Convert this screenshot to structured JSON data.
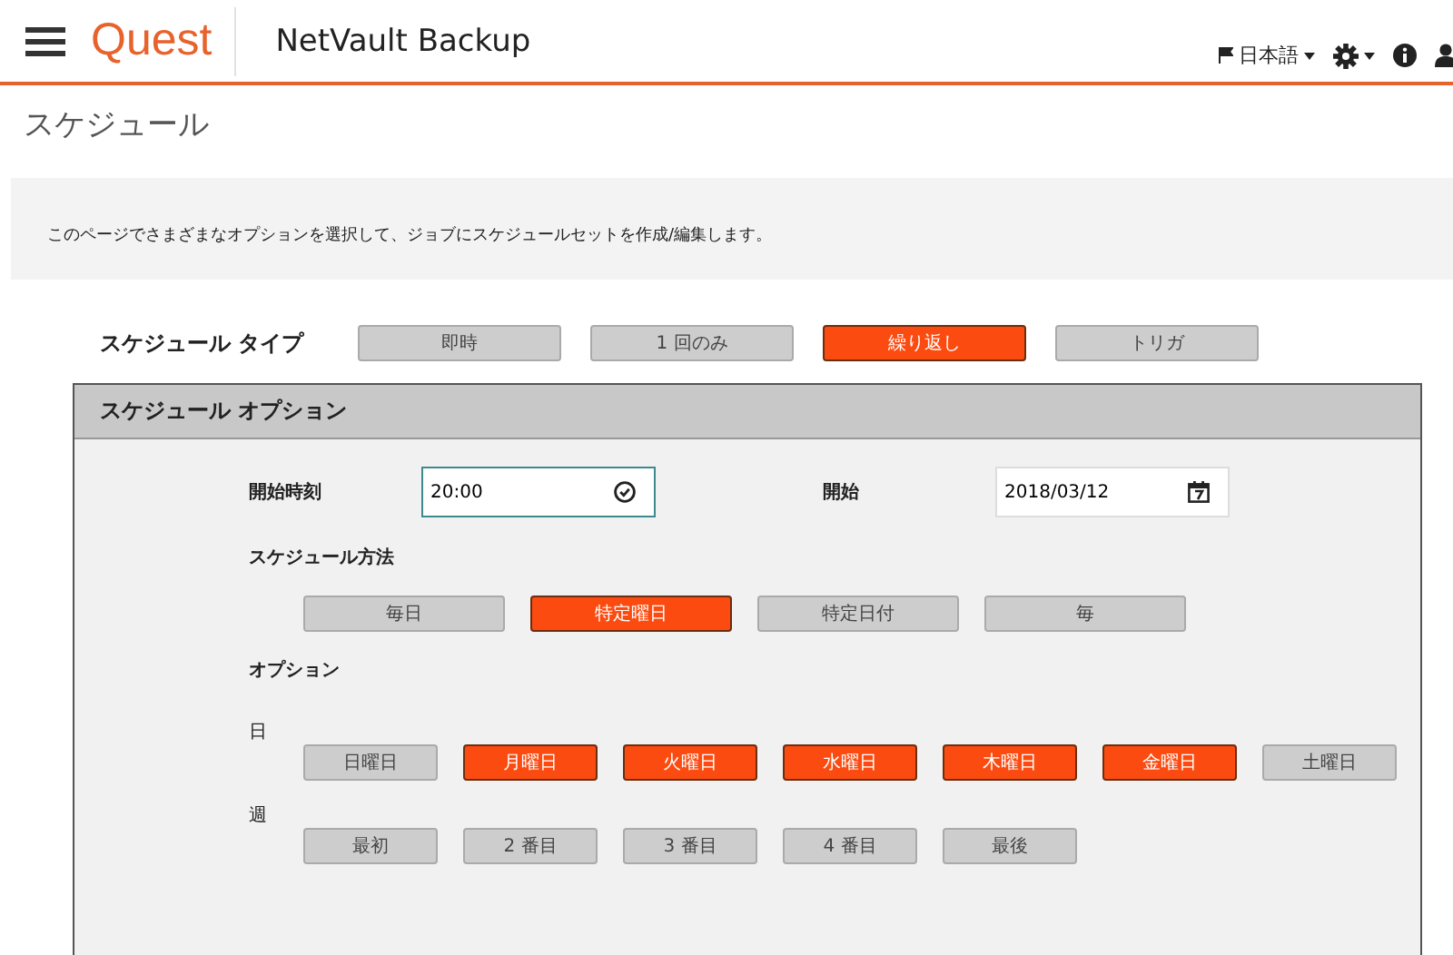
{
  "header": {
    "logo": "Quest",
    "product": "NetVault Backup",
    "language": "日本語"
  },
  "page_title": "スケジュール",
  "description": "このページでさまざまなオプションを選択して、ジョブにスケジュールセットを作成/編集します。",
  "schedule_type": {
    "label": "スケジュール タイプ",
    "options": [
      {
        "label": "即時",
        "selected": false
      },
      {
        "label": "1 回のみ",
        "selected": false
      },
      {
        "label": "繰り返し",
        "selected": true
      },
      {
        "label": "トリガ",
        "selected": false
      }
    ]
  },
  "schedule_options": {
    "title": "スケジュール オプション",
    "start_time": {
      "label": "開始時刻",
      "value": "20:00",
      "focused": true
    },
    "start_date": {
      "label": "開始",
      "value": "2018/03/12"
    },
    "method": {
      "label": "スケジュール方法",
      "options": [
        {
          "label": "毎日",
          "selected": false
        },
        {
          "label": "特定曜日",
          "selected": true
        },
        {
          "label": "特定日付",
          "selected": false
        },
        {
          "label": "毎",
          "selected": false
        }
      ]
    },
    "options_label": "オプション",
    "days": {
      "label": "日",
      "options": [
        {
          "label": "日曜日",
          "selected": false
        },
        {
          "label": "月曜日",
          "selected": true
        },
        {
          "label": "火曜日",
          "selected": true
        },
        {
          "label": "水曜日",
          "selected": true
        },
        {
          "label": "木曜日",
          "selected": true
        },
        {
          "label": "金曜日",
          "selected": true
        },
        {
          "label": "土曜日",
          "selected": false
        }
      ]
    },
    "weeks": {
      "label": "週",
      "options": [
        {
          "label": "最初",
          "selected": false
        },
        {
          "label": "2 番目",
          "selected": false
        },
        {
          "label": "3 番目",
          "selected": false
        },
        {
          "label": "4 番目",
          "selected": false
        },
        {
          "label": "最後",
          "selected": false
        }
      ]
    }
  }
}
